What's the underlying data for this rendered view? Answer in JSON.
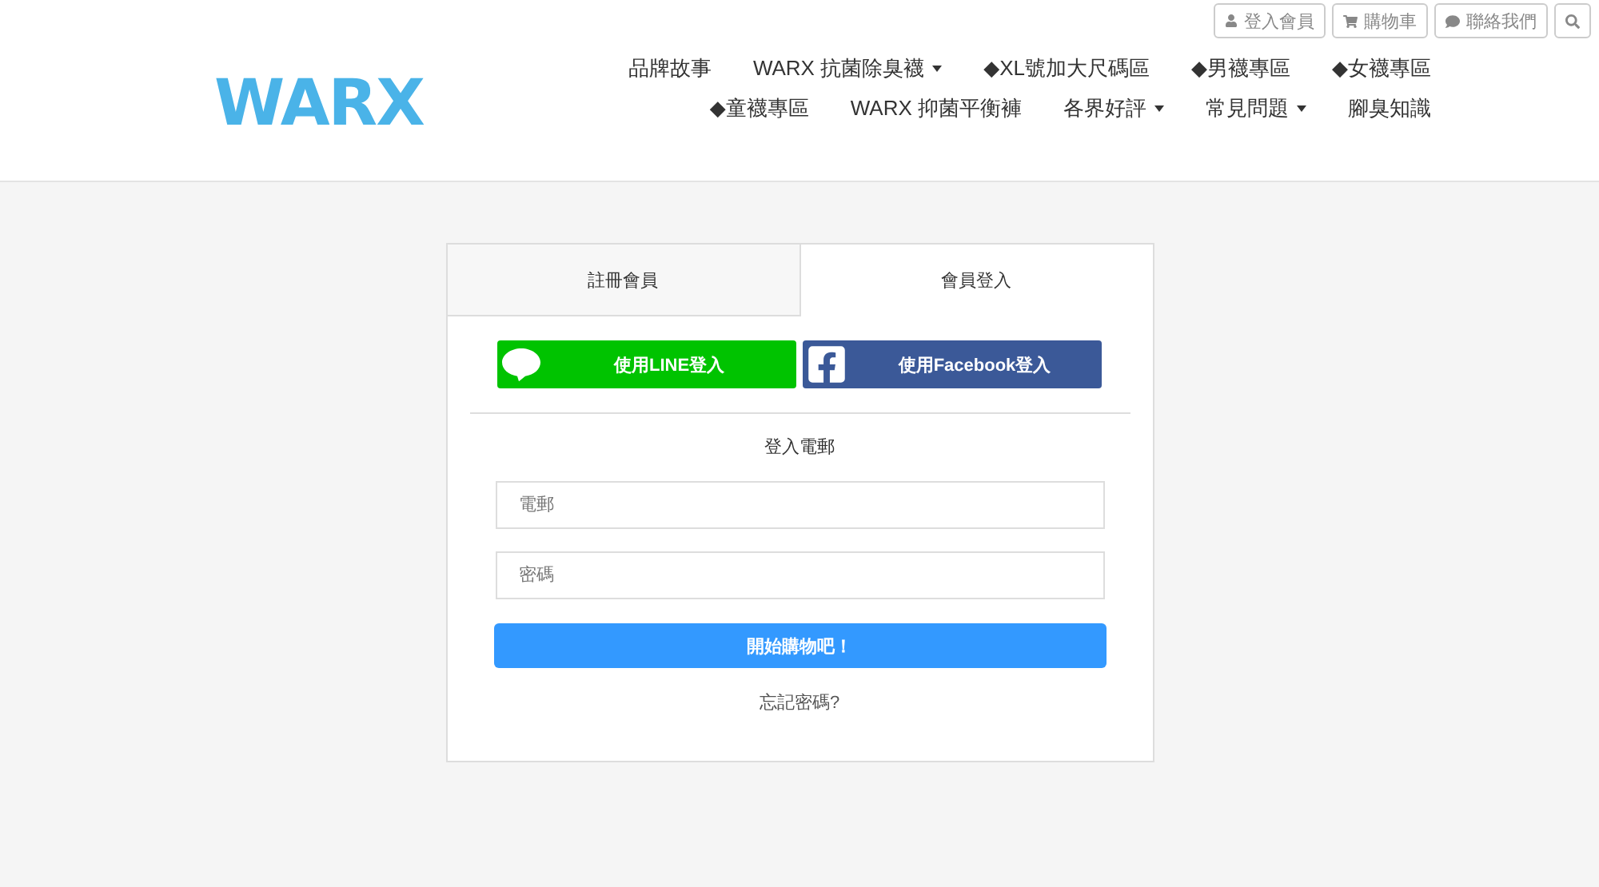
{
  "top_links": [
    {
      "kind": "user",
      "label": "登入會員"
    },
    {
      "kind": "cart",
      "label": "購物車"
    },
    {
      "kind": "chat",
      "label": "聯絡我們"
    },
    {
      "kind": "search"
    }
  ],
  "logo": "WARX",
  "nav_rows": [
    [
      {
        "label": "品牌故事",
        "dropdown": false
      },
      {
        "label": "WARX 抗菌除臭襪",
        "dropdown": true
      },
      {
        "label": "◆XL號加大尺碼區",
        "dropdown": false
      },
      {
        "label": "◆男襪專區",
        "dropdown": false
      },
      {
        "label": "◆女襪專區",
        "dropdown": false
      }
    ],
    [
      {
        "label": "◆童襪專區",
        "dropdown": false
      },
      {
        "label": "WARX 抑菌平衡褲",
        "dropdown": false
      },
      {
        "label": "各界好評",
        "dropdown": true
      },
      {
        "label": "常見問題",
        "dropdown": true
      },
      {
        "label": "腳臭知識",
        "dropdown": false
      }
    ]
  ],
  "tabs": [
    {
      "label": "註冊會員",
      "selected": false
    },
    {
      "label": "會員登入",
      "selected": true
    }
  ],
  "social": [
    {
      "kind": "line",
      "label": "使用LINE登入",
      "color": "#00c300"
    },
    {
      "kind": "facebook",
      "label": "使用Facebook登入",
      "color": "#3b5998"
    }
  ],
  "section_title": "登入電郵",
  "fields": [
    {
      "placeholder": "電郵"
    },
    {
      "placeholder": "密碼"
    }
  ],
  "submit": "開始購物吧！",
  "forgot": "忘記密碼?"
}
